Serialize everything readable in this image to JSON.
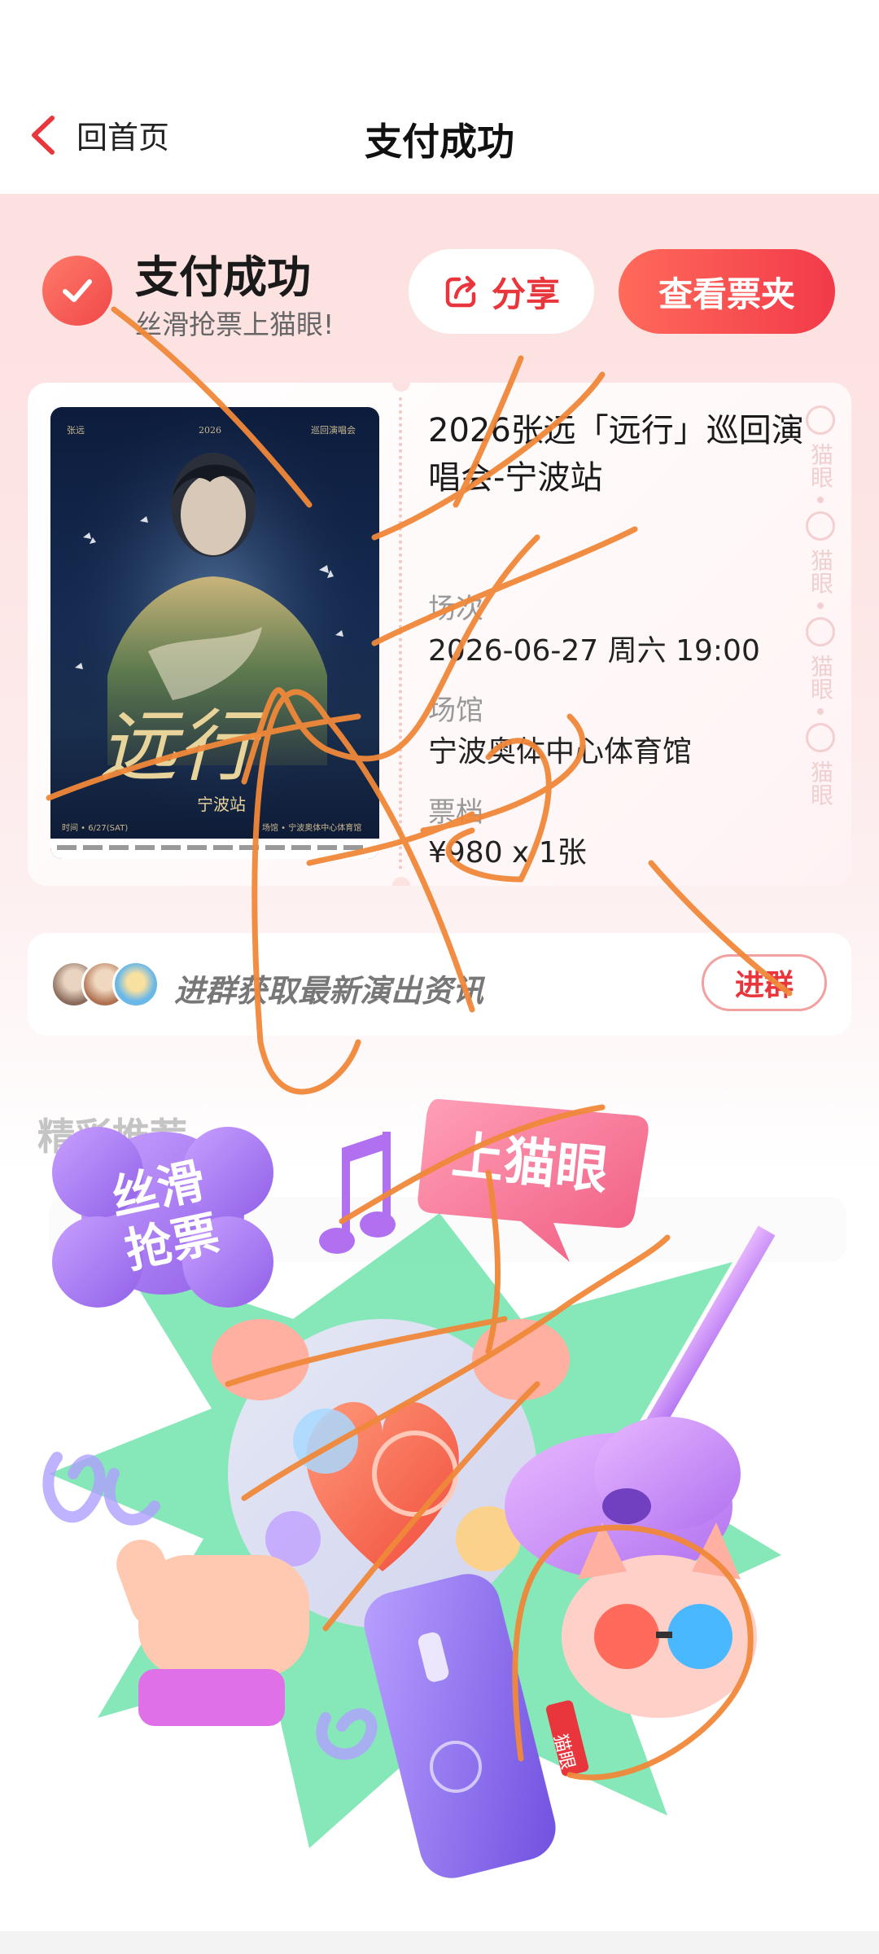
{
  "nav": {
    "back_label": "回首页",
    "title": "支付成功"
  },
  "success": {
    "title": "支付成功",
    "subtitle": "丝滑抢票上猫眼!",
    "share_label": "分享",
    "view_tickets_label": "查看票夹"
  },
  "ticket": {
    "event_title": "2026张远「远行」巡回演唱会-宁波站",
    "session_label": "场次",
    "session_value": "2026-06-27 周六 19:00",
    "venue_label": "场馆",
    "venue_value": "宁波奥体中心体育馆",
    "tier_label": "票档",
    "tier_value": "¥980 x 1张",
    "watermark_text": "猫眼",
    "poster": {
      "artist": "张远",
      "year": "2026",
      "tour": "巡回演唱会",
      "calligraphy": "远行",
      "city": "宁波站",
      "time_line": "时间 • 6/27(SAT)",
      "venue_line": "场馆 • 宁波奥体中心体育馆"
    }
  },
  "group": {
    "text": "进群获取最新演出资讯",
    "join_label": "进群"
  },
  "recommend": {
    "title": "精彩推荐"
  },
  "promo": {
    "badge_left": "丝滑\n抢票",
    "badge_right": "上猫眼",
    "tag_text": "猫眼"
  },
  "colors": {
    "accent_red": "#e8363c",
    "button_gradient_start": "#ff6a5a",
    "button_gradient_end": "#f23a4a",
    "pink_background": "#fde0e0",
    "scribble_orange": "#f0883a"
  }
}
